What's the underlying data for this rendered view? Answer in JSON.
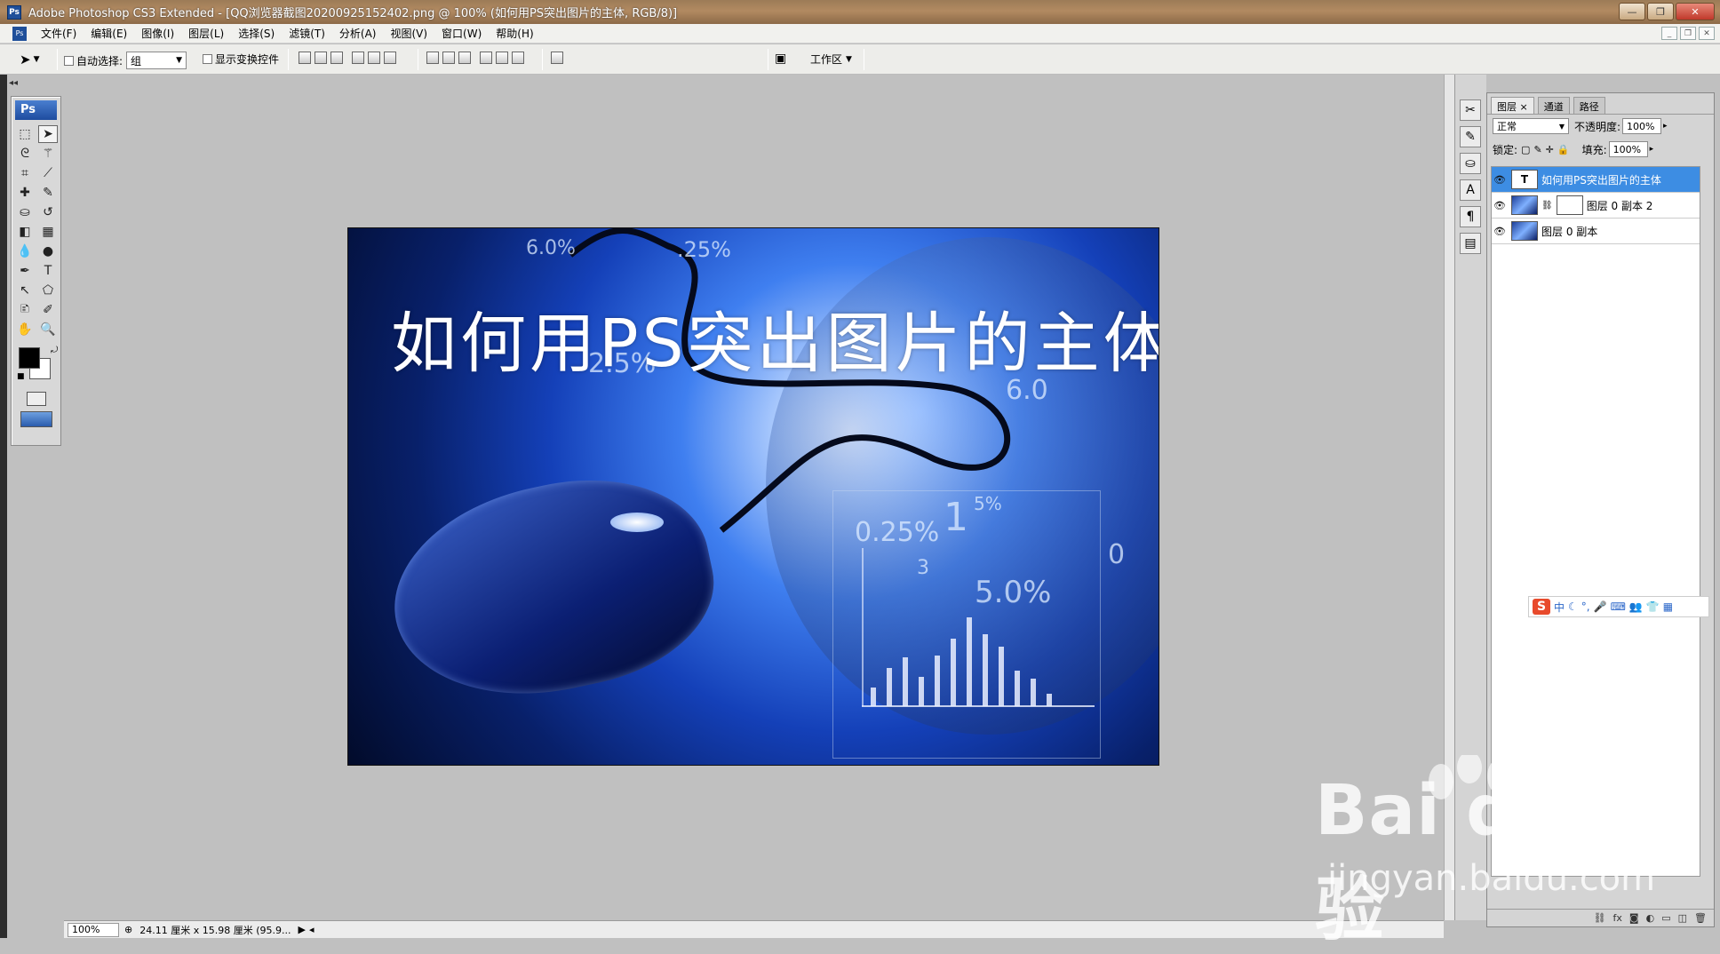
{
  "window": {
    "title": "Adobe Photoshop CS3 Extended - [QQ浏览器截图20200925152402.png @ 100% (如何用PS突出图片的主体, RGB/8)]",
    "app_badge": "Ps"
  },
  "menu": [
    "文件(F)",
    "编辑(E)",
    "图像(I)",
    "图层(L)",
    "选择(S)",
    "滤镜(T)",
    "分析(A)",
    "视图(V)",
    "窗口(W)",
    "帮助(H)"
  ],
  "options": {
    "auto_select_label": "自动选择:",
    "auto_select_value": "组",
    "show_transform_label": "显示变换控件",
    "workspace_label": "工作区"
  },
  "toolbox": {
    "logo": "Ps",
    "icons": [
      "rect-marquee-icon",
      "move-icon",
      "lasso-icon",
      "magic-wand-icon",
      "crop-icon",
      "slice-icon",
      "healing-brush-icon",
      "brush-icon",
      "clone-stamp-icon",
      "history-brush-icon",
      "eraser-icon",
      "gradient-icon",
      "blur-icon",
      "dodge-icon",
      "pen-icon",
      "type-icon",
      "path-select-icon",
      "shape-icon",
      "notes-icon",
      "eyedropper-icon",
      "hand-icon",
      "zoom-icon"
    ],
    "fg_color": "#000000",
    "bg_color": "#ffffff"
  },
  "image": {
    "headline": "如何用PS突出图片的主体",
    "percent_labels": [
      "6.0%",
      ".25%",
      "2.5%",
      "6.0",
      "0.25%",
      "1",
      "5%",
      "3",
      "5.0%",
      "0"
    ]
  },
  "chart_bars": [
    18,
    36,
    46,
    28,
    48,
    64,
    84,
    68,
    56,
    34,
    26,
    12
  ],
  "layers_panel": {
    "tabs": [
      "图层",
      "通道",
      "路径"
    ],
    "blend_mode": "正常",
    "opacity_label": "不透明度:",
    "opacity_value": "100%",
    "lock_label": "锁定:",
    "fill_label": "填充:",
    "fill_value": "100%",
    "layers": [
      {
        "name": "如何用PS突出图片的主体",
        "type": "text",
        "selected": true
      },
      {
        "name": "图层 0 副本 2",
        "type": "image-mask",
        "selected": false
      },
      {
        "name": "图层 0 副本",
        "type": "image",
        "selected": false
      }
    ]
  },
  "ime": {
    "badge": "S",
    "lang": "中"
  },
  "status": {
    "zoom": "100%",
    "doc_info": "24.11 厘米 x 15.98 厘米 (95.9..."
  },
  "watermark": {
    "main": "Bai du 经验",
    "sub": "jingyan.baidu.com"
  },
  "colors": {
    "selection": "#3d8de3",
    "titlebar": "#a98460",
    "ime_accent": "#e84a2c"
  }
}
